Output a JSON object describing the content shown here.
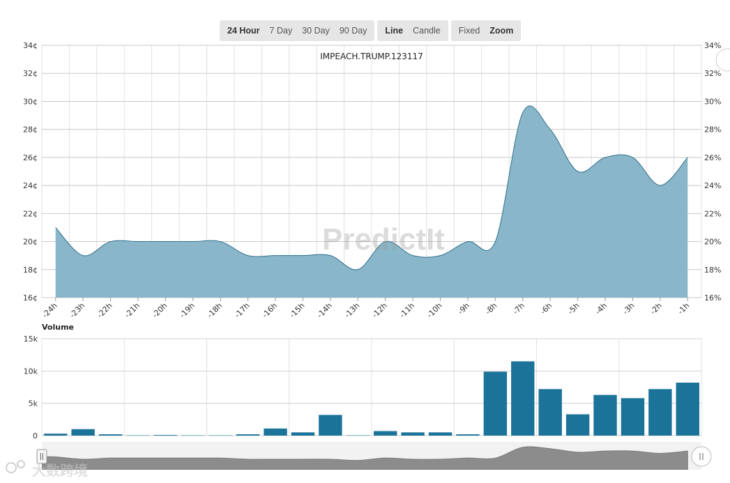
{
  "toolbar": {
    "range": [
      {
        "label": "24 Hour",
        "active": true
      },
      {
        "label": "7 Day",
        "active": false
      },
      {
        "label": "30 Day",
        "active": false
      },
      {
        "label": "90 Day",
        "active": false
      }
    ],
    "type": [
      {
        "label": "Line",
        "active": true
      },
      {
        "label": "Candle",
        "active": false
      }
    ],
    "scale": [
      {
        "label": "Fixed",
        "active": false
      },
      {
        "label": "Zoom",
        "active": true
      }
    ]
  },
  "watermark": "PredictIt",
  "corner_watermark": "大数跨境",
  "chart_data": [
    {
      "type": "area",
      "title": "IMPEACH.TRUMP.123117",
      "categories": [
        "-24h",
        "-23h",
        "-22h",
        "-21h",
        "-20h",
        "-19h",
        "-18h",
        "-17h",
        "-16h",
        "-15h",
        "-14h",
        "-13h",
        "-12h",
        "-11h",
        "-10h",
        "-9h",
        "-8h",
        "-7h",
        "-6h",
        "-5h",
        "-4h",
        "-3h",
        "-2h",
        "-1h"
      ],
      "x": [
        -23.5,
        -22.5,
        -21.5,
        -20.5,
        -19.5,
        -18.5,
        -17.5,
        -16.5,
        -15.5,
        -14.5,
        -13.5,
        -12.5,
        -11.5,
        -10.5,
        -9.5,
        -8.5,
        -7.5,
        -6.5,
        -5.5,
        -4.5,
        -3.5,
        -2.5,
        -1.5,
        -0.5
      ],
      "values": [
        21,
        19,
        20,
        20,
        20,
        20,
        20,
        19,
        19,
        19,
        19,
        18,
        20,
        19,
        19,
        20,
        20,
        29.2,
        28,
        25,
        26,
        26,
        24,
        26
      ],
      "ylim": [
        16,
        34
      ],
      "y_ticks_left": [
        "16¢",
        "18¢",
        "20¢",
        "22¢",
        "24¢",
        "26¢",
        "28¢",
        "30¢",
        "32¢",
        "34¢"
      ],
      "y_ticks_right": [
        "16%",
        "18%",
        "20%",
        "22%",
        "24%",
        "26%",
        "28%",
        "30%",
        "32%",
        "34%"
      ],
      "fill_color": "#8ab6ca",
      "line_color": "#2f6f8d",
      "grid": true
    },
    {
      "type": "bar",
      "title": "Volume",
      "categories": [
        "-24h",
        "-23h",
        "-22h",
        "-21h",
        "-20h",
        "-19h",
        "-18h",
        "-17h",
        "-16h",
        "-15h",
        "-14h",
        "-13h",
        "-12h",
        "-11h",
        "-10h",
        "-9h",
        "-8h",
        "-7h",
        "-6h",
        "-5h",
        "-4h",
        "-3h",
        "-2h",
        "-1h"
      ],
      "values": [
        300,
        1000,
        200,
        50,
        100,
        50,
        50,
        200,
        1100,
        500,
        3200,
        50,
        700,
        500,
        500,
        200,
        9900,
        11500,
        7200,
        3300,
        6300,
        5800,
        7200,
        8200
      ],
      "ylim": [
        0,
        15000
      ],
      "y_ticks": [
        "0",
        "5k",
        "10k",
        "15k"
      ],
      "bar_color": "#1b7399",
      "grid": true
    }
  ]
}
